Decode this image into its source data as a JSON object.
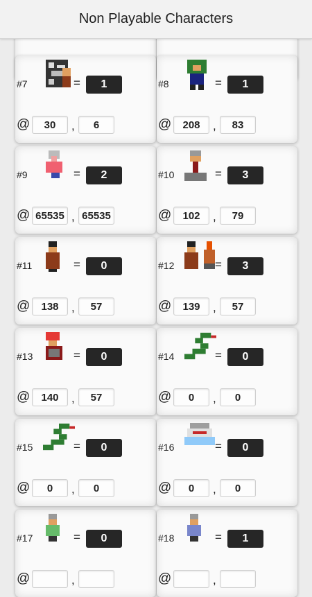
{
  "title": "Non Playable Characters",
  "npcs": [
    {
      "id": "#7",
      "count": "1",
      "x": "30",
      "y": "6",
      "sprite": "ghost-dark-sprite"
    },
    {
      "id": "#8",
      "count": "1",
      "x": "208",
      "y": "83",
      "sprite": "green-haired-sprite"
    },
    {
      "id": "#9",
      "count": "2",
      "x": "65535",
      "y": "65535",
      "sprite": "old-woman-sprite"
    },
    {
      "id": "#10",
      "count": "3",
      "x": "102",
      "y": "79",
      "sprite": "shopkeeper-sprite"
    },
    {
      "id": "#11",
      "count": "0",
      "x": "138",
      "y": "57",
      "sprite": "brown-robe-sprite"
    },
    {
      "id": "#12",
      "count": "3",
      "x": "139",
      "y": "57",
      "sprite": "brown-robe-fox-sprite"
    },
    {
      "id": "#13",
      "count": "0",
      "x": "140",
      "y": "57",
      "sprite": "red-haired-sprite"
    },
    {
      "id": "#14",
      "count": "0",
      "x": "0",
      "y": "0",
      "sprite": "serpent-sprite"
    },
    {
      "id": "#15",
      "count": "0",
      "x": "0",
      "y": "0",
      "sprite": "serpent-sprite"
    },
    {
      "id": "#16",
      "count": "0",
      "x": "0",
      "y": "0",
      "sprite": "shark-sprite"
    },
    {
      "id": "#17",
      "count": "0",
      "x": "",
      "y": "",
      "sprite": "green-villager-sprite"
    },
    {
      "id": "#18",
      "count": "1",
      "x": "",
      "y": "",
      "sprite": "blue-villager-sprite"
    }
  ],
  "symbols": {
    "equals": "=",
    "at": "@",
    "comma": ","
  }
}
